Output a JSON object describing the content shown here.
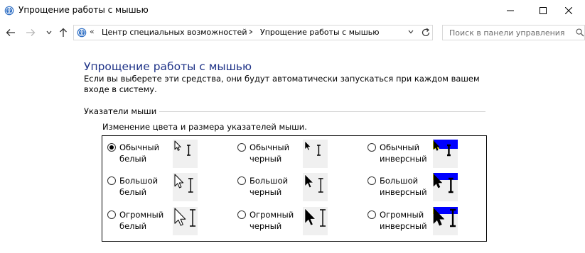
{
  "window": {
    "title": "Упрощение работы с мышью",
    "icon": "ease-of-access-icon",
    "controls": [
      "minimize-icon",
      "maximize-icon",
      "close-icon"
    ]
  },
  "address_bar": {
    "overflow_chevron": "«",
    "crumbs": [
      "Центр специальных возможностей",
      "Упрощение работы с мышью"
    ],
    "search_placeholder": "Поиск в панели управления"
  },
  "page": {
    "title": "Упрощение работы с мышью",
    "description": "Если вы выберете эти средства, они будут автоматически запускаться при каждом вашем входе в систему.",
    "section_label": "Указатели мыши",
    "sub_label": "Изменение цвета и размера указателей мыши."
  },
  "pointer_schemes": [
    {
      "line1": "Обычный",
      "line2": "белый",
      "selected": true,
      "style": "white",
      "size": "normal"
    },
    {
      "line1": "Обычный",
      "line2": "черный",
      "selected": false,
      "style": "black",
      "size": "normal"
    },
    {
      "line1": "Обычный",
      "line2": "инверсный",
      "selected": false,
      "style": "inverse",
      "size": "normal"
    },
    {
      "line1": "Большой",
      "line2": "белый",
      "selected": false,
      "style": "white",
      "size": "large"
    },
    {
      "line1": "Большой",
      "line2": "черный",
      "selected": false,
      "style": "black",
      "size": "large"
    },
    {
      "line1": "Большой",
      "line2": "инверсный",
      "selected": false,
      "style": "inverse",
      "size": "large"
    },
    {
      "line1": "Огромный",
      "line2": "белый",
      "selected": false,
      "style": "white",
      "size": "huge"
    },
    {
      "line1": "Огромный",
      "line2": "черный",
      "selected": false,
      "style": "black",
      "size": "huge"
    },
    {
      "line1": "Огромный",
      "line2": "инверсный",
      "selected": false,
      "style": "inverse",
      "size": "huge"
    }
  ],
  "colors": {
    "title_accent": "#1e3287",
    "inverse_blue": "#0000ff",
    "inverse_yellow": "#ffff00"
  }
}
